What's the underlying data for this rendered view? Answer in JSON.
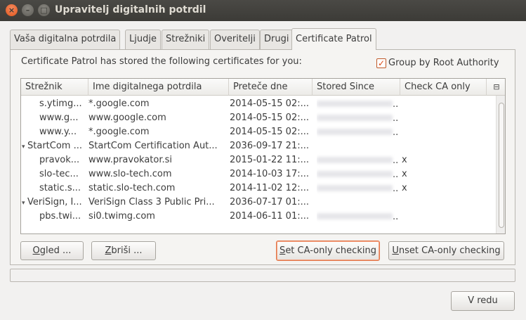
{
  "window": {
    "title": "Upravitelj digitalnih potrdil",
    "close_glyph": "×",
    "min_glyph": "–",
    "max_glyph": "□"
  },
  "tabs": [
    {
      "label": "Vaša digitalna potrdila"
    },
    {
      "label": "Ljudje"
    },
    {
      "label": "Strežniki"
    },
    {
      "label": "Overitelji"
    },
    {
      "label": "Drugi"
    },
    {
      "label": "Certificate Patrol"
    }
  ],
  "panel": {
    "info_text": "Certificate Patrol has stored the following certificates for you:",
    "group_checkbox": {
      "label": "Group by Root Authority",
      "checked": true,
      "mark": "✓"
    }
  },
  "table": {
    "columns": [
      "Strežnik",
      "Ime digitalnega potrdila",
      "Preteče dne",
      "Stored Since",
      "Check CA only"
    ],
    "picker_icon": "⊟",
    "rows": [
      {
        "server": "s.ytimg...",
        "cert": "*.google.com",
        "expires": "2014-05-15 02:...",
        "since_trail": "..",
        "check": "",
        "group": false
      },
      {
        "server": "www.g...",
        "cert": "www.google.com",
        "expires": "2014-05-15 02:...",
        "since_trail": "..",
        "check": "",
        "group": false
      },
      {
        "server": "www.y...",
        "cert": "*.google.com",
        "expires": "2014-05-15 02:...",
        "since_trail": "..",
        "check": "",
        "group": false
      },
      {
        "server": "StartCom ...",
        "cert": "StartCom Certification Aut...",
        "expires": "2036-09-17 21:...",
        "since_trail": "",
        "check": "",
        "group": true
      },
      {
        "server": "pravok...",
        "cert": "www.pravokator.si",
        "expires": "2015-01-22 11:...",
        "since_trail": "..",
        "check": "x",
        "group": false
      },
      {
        "server": "slo-tec...",
        "cert": "www.slo-tech.com",
        "expires": "2014-10-03 17:...",
        "since_trail": "..",
        "check": "x",
        "group": false
      },
      {
        "server": "static.s...",
        "cert": "static.slo-tech.com",
        "expires": "2014-11-02 12:...",
        "since_trail": "..",
        "check": "x",
        "group": false
      },
      {
        "server": "VeriSign, I...",
        "cert": "VeriSign Class 3 Public Pri...",
        "expires": "2036-07-17 01:...",
        "since_trail": "",
        "check": "",
        "group": true
      },
      {
        "server": "pbs.twi...",
        "cert": "si0.twimg.com",
        "expires": "2014-06-11 01:...",
        "since_trail": "..",
        "check": "",
        "group": false
      }
    ],
    "expander_glyph": "▾"
  },
  "buttons": {
    "view": {
      "underline": "O",
      "rest": "gled ..."
    },
    "delete": {
      "underline": "Z",
      "rest": "briši ..."
    },
    "set_ca": {
      "underline": "S",
      "rest": "et CA-only checking"
    },
    "unset_ca": {
      "underline": "U",
      "rest": "nset CA-only checking"
    },
    "ok": {
      "label": "V redu"
    }
  }
}
